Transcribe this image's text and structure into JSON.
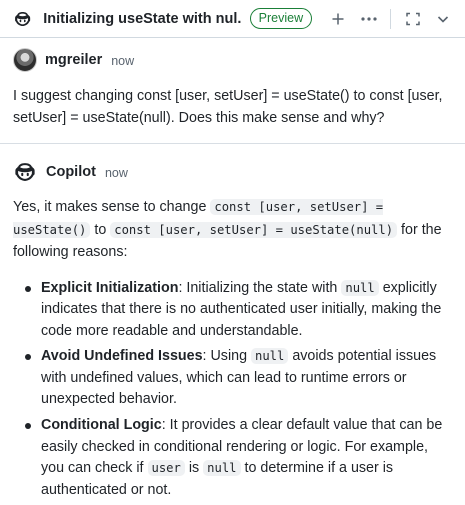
{
  "header": {
    "title": "Initializing useState with nul...",
    "badge": "Preview"
  },
  "user_message": {
    "author": "mgreiler",
    "time": "now",
    "text": "I suggest changing const [user, setUser] = useState() to const [user, setUser] = useState(null). Does this make sense and why?"
  },
  "bot_message": {
    "author": "Copilot",
    "time": "now",
    "intro_pre": "Yes, it makes sense to change ",
    "intro_code1": "const [user, setUser] = useState()",
    "intro_mid": " to ",
    "intro_code2": "const [user, setUser] = useState(null)",
    "intro_post": " for the following reasons:",
    "items": [
      {
        "title": "Explicit Initialization",
        "t1": ": Initializing the state with ",
        "c1": "null",
        "t2": " explicitly indicates that there is no authenticated user initially, making the code more readable and understandable."
      },
      {
        "title": "Avoid Undefined Issues",
        "t1": ": Using ",
        "c1": "null",
        "t2": " avoids potential issues with undefined values, which can lead to runtime errors or unexpected behavior."
      },
      {
        "title": "Conditional Logic",
        "t1": ": It provides a clear default value that can be easily checked in conditional rendering or logic. For example, you can check if ",
        "c1": "user",
        "t2": " is ",
        "c2": "null",
        "t3": " to determine if a user is authenticated or not."
      }
    ]
  },
  "icons": {
    "copilot": "copilot-icon",
    "new_chat": "plus-icon",
    "more": "kebab-horizontal-icon",
    "fullscreen": "screen-full-icon",
    "collapse": "chevron-down-icon"
  }
}
